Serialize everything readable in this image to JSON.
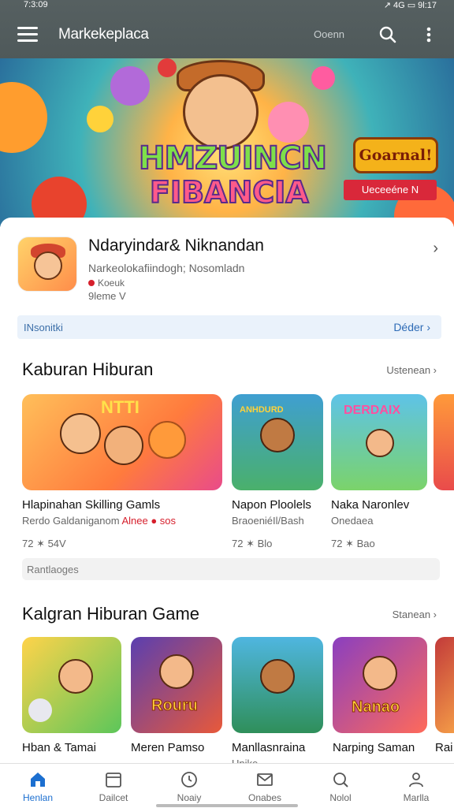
{
  "status_bar": {
    "time": "7:3:09",
    "right": "↗ 4G ▭ 9l:17"
  },
  "app_bar": {
    "title": "Markekeplaca",
    "search_chip": "Ooenn"
  },
  "hero": {
    "title_line1": "HMZUINCN",
    "title_line2": "FIBANCIA",
    "badge": "Goarnal!",
    "cta": "Ueceeéne N"
  },
  "featured": {
    "name": "Ndaryindar& Niknandan",
    "subtitle": "Narkeolokafiindogh; Nosomladn",
    "tag": "Koeuk",
    "meta": "9leme V"
  },
  "notice": {
    "left": "INsonitki",
    "right": "Déder ›"
  },
  "section1": {
    "title": "Kaburan Hiburan",
    "more": "Ustenean ›",
    "cards": [
      {
        "name": "Hlapinahan Skilling Gamls",
        "sub": "Rerdo Galdaniganom",
        "sub_red": "Alnee ● sos",
        "meta": "72 ✶ 54V"
      },
      {
        "name": "Napon Ploolels",
        "sub": "BraoeniéIl/Bash",
        "sub_red": "",
        "meta": "72 ✶ Blo"
      },
      {
        "name": "Naka Naronlev",
        "sub": "Onedaea",
        "sub_red": "",
        "meta": "72 ✶ Bao"
      }
    ],
    "thumb_text": [
      "NTTI",
      "ANHDURD",
      "DERDAIX"
    ]
  },
  "pill": {
    "label": "Rantlaoges"
  },
  "section2": {
    "title": "Kalgran Hiburan Game",
    "more": "Stanean ›",
    "cards": [
      {
        "name": "Hban & Tamai",
        "sub": ""
      },
      {
        "name": "Meren Pamso",
        "sub": ""
      },
      {
        "name": "Manllasnraina",
        "sub": "Unike"
      },
      {
        "name": "Narping Saman",
        "sub": ""
      },
      {
        "name": "Rai",
        "sub": ""
      }
    ],
    "thumb_text": [
      "",
      "Rouru",
      "",
      "Nanao",
      ""
    ]
  },
  "bottom_nav": [
    {
      "label": "Henlan",
      "icon": "home-icon",
      "active": true
    },
    {
      "label": "Dailcet",
      "icon": "calendar-icon",
      "active": false
    },
    {
      "label": "Noaiy",
      "icon": "clock-icon",
      "active": false
    },
    {
      "label": "Onabes",
      "icon": "mail-icon",
      "active": false
    },
    {
      "label": "Nolol",
      "icon": "search-icon",
      "active": false
    },
    {
      "label": "Marlla",
      "icon": "person-icon",
      "active": false
    }
  ],
  "colors": {
    "accent": "#1c6fd0",
    "app_bar": "#535d5e",
    "badge_red": "#d61f2c"
  }
}
